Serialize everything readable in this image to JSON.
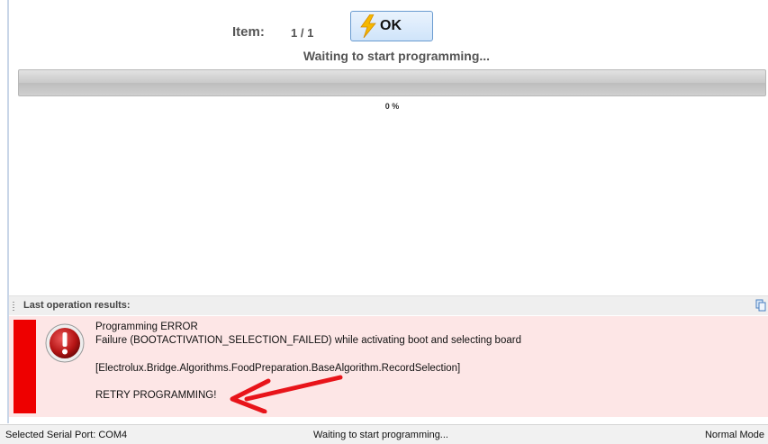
{
  "header": {
    "item_label": "Item:",
    "item_count": "1 / 1",
    "ok_label": "OK",
    "ok_icon": "lightning-bolt-icon",
    "status": "Waiting to start programming..."
  },
  "progress": {
    "value": 0,
    "percent_text": "0 %"
  },
  "results": {
    "title": "Last operation results:",
    "copy_icon": "copy-icon",
    "error_icon": "error-exclamation-icon",
    "lines": [
      "Programming ERROR",
      "Failure (BOOTACTIVATION_SELECTION_FAILED) while activating boot and selecting board",
      "[Electrolux.Bridge.Algorithms.FoodPreparation.BaseAlgorithm.RecordSelection]",
      "RETRY PROGRAMMING!"
    ],
    "colors": {
      "panel": "#fde6e6",
      "bar": "#ee0000",
      "arrow": "#e8141a"
    }
  },
  "statusbar": {
    "serial_port": "Selected Serial Port: COM4",
    "state": "Waiting to start programming...",
    "mode": "Normal Mode"
  }
}
